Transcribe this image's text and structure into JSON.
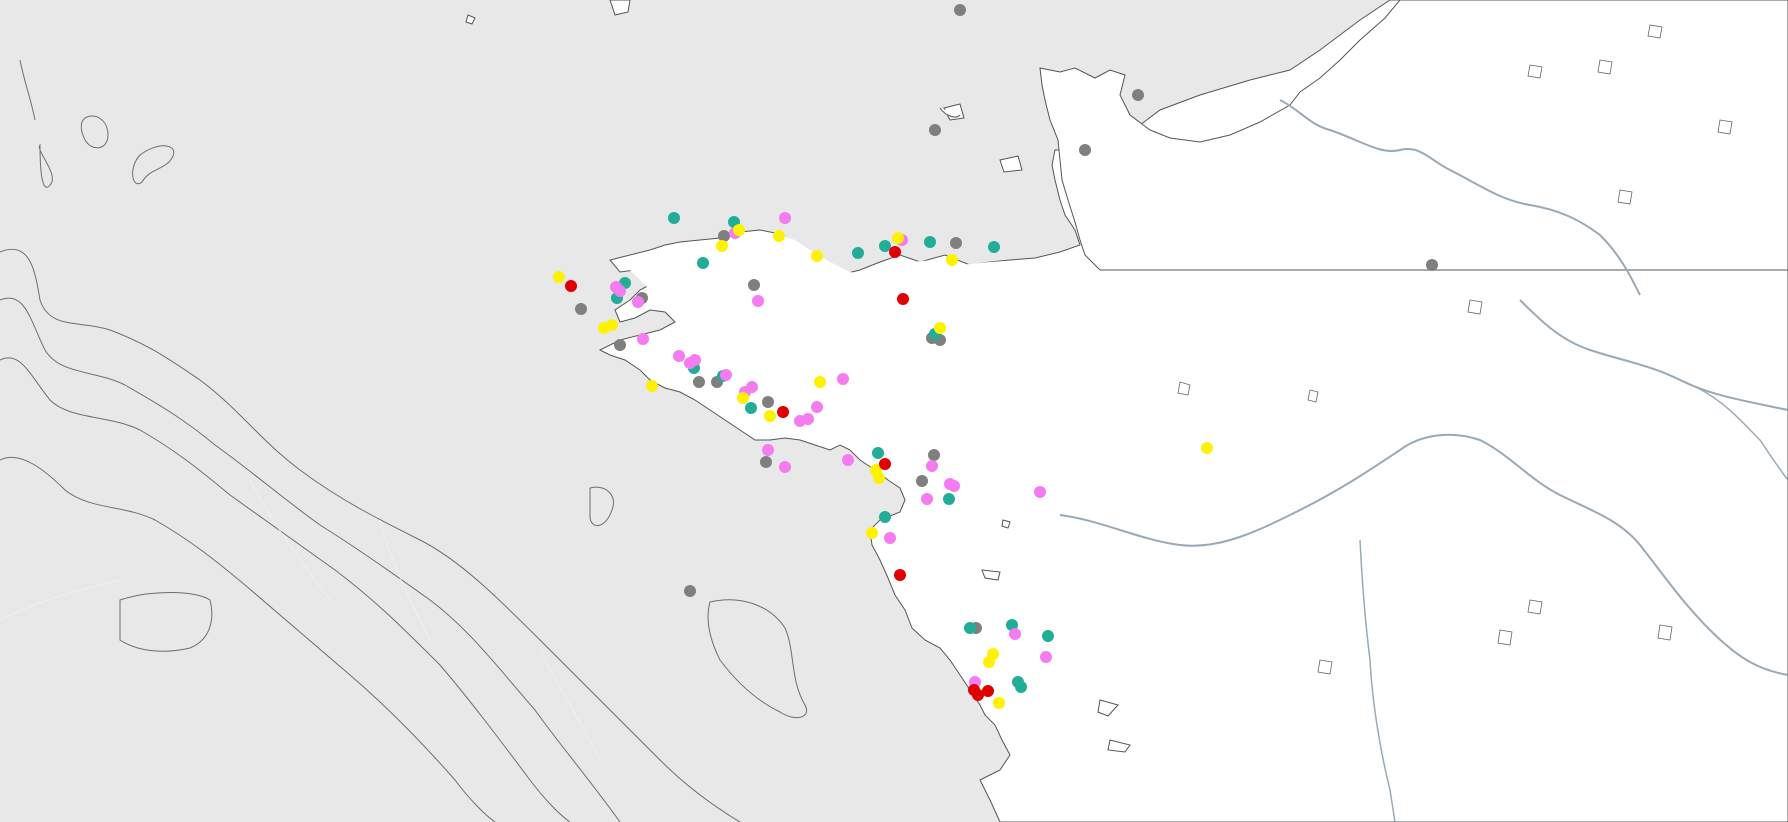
{
  "map": {
    "style": "light basemap, gray sea, white land, no visible labels",
    "colors": {
      "sea": "#e8e8e8",
      "land": "#ffffff",
      "coastline": "#555555",
      "bathymetry": "#7a7a7a",
      "river": "#9aa9b6",
      "gray": "#7f7f7f",
      "teal": "#21ad97",
      "pink": "#f47bf0",
      "yellow": "#fff200",
      "red": "#e00000"
    },
    "marker_categories": [
      "gray",
      "teal",
      "pink",
      "yellow",
      "red"
    ]
  }
}
